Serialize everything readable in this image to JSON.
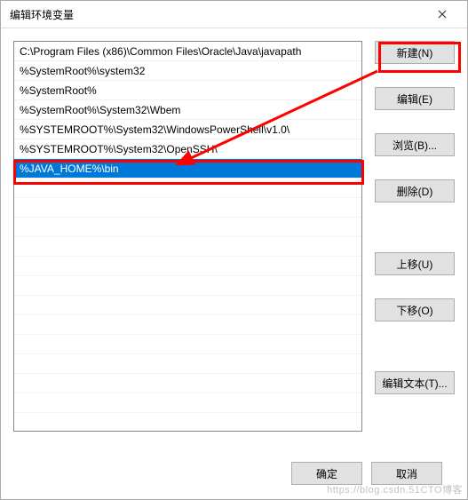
{
  "window": {
    "title": "编辑环境变量"
  },
  "list": {
    "items": [
      "C:\\Program Files (x86)\\Common Files\\Oracle\\Java\\javapath",
      "%SystemRoot%\\system32",
      "%SystemRoot%",
      "%SystemRoot%\\System32\\Wbem",
      "%SYSTEMROOT%\\System32\\WindowsPowerShell\\v1.0\\",
      "%SYSTEMROOT%\\System32\\OpenSSH\\",
      "%JAVA_HOME%\\bin"
    ],
    "selected_index": 6
  },
  "buttons": {
    "new": "新建(N)",
    "edit": "编辑(E)",
    "browse": "浏览(B)...",
    "delete": "删除(D)",
    "move_up": "上移(U)",
    "move_down": "下移(O)",
    "edit_text": "编辑文本(T)...",
    "ok": "确定",
    "cancel": "取消"
  },
  "watermark": "https://blog.csdn.51CTO博客"
}
